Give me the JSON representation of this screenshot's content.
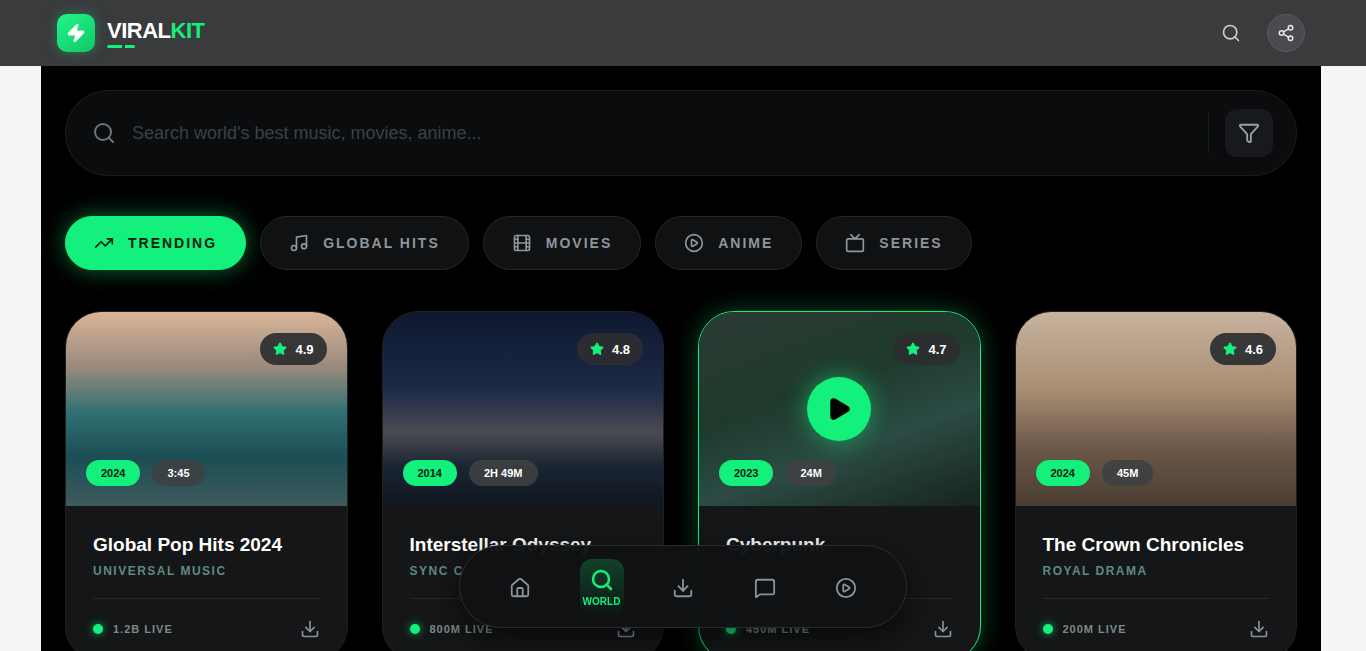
{
  "brand": {
    "lead": "VIRAL",
    "accent": "KIT"
  },
  "search": {
    "placeholder": "Search world's best music, movies, anime..."
  },
  "categories": [
    {
      "label": "TRENDING",
      "selected": true
    },
    {
      "label": "GLOBAL HITS",
      "selected": false
    },
    {
      "label": "MOVIES",
      "selected": false
    },
    {
      "label": "ANIME",
      "selected": false
    },
    {
      "label": "SERIES",
      "selected": false
    }
  ],
  "cards": [
    {
      "title": "Global Pop Hits 2024",
      "subtitle": "UNIVERSAL MUSIC",
      "rating": "4.9",
      "year": "2024",
      "duration": "3:45",
      "live": "1.2B LIVE",
      "selected": false
    },
    {
      "title": "Interstellar Odyssey",
      "subtitle": "SYNC C",
      "rating": "4.8",
      "year": "2014",
      "duration": "2H 49M",
      "live": "800M LIVE",
      "selected": false
    },
    {
      "title": "Cyberpunk",
      "subtitle": "",
      "rating": "4.7",
      "year": "2023",
      "duration": "24M",
      "live": "450M LIVE",
      "selected": true
    },
    {
      "title": "The Crown Chronicles",
      "subtitle": "ROYAL DRAMA",
      "rating": "4.6",
      "year": "2024",
      "duration": "45M",
      "live": "200M LIVE",
      "selected": false
    }
  ],
  "bottom_nav": [
    {
      "label": "",
      "selected": false
    },
    {
      "label": "WORLD",
      "selected": true
    },
    {
      "label": "",
      "selected": false
    },
    {
      "label": "",
      "selected": false
    },
    {
      "label": "",
      "selected": false
    }
  ]
}
